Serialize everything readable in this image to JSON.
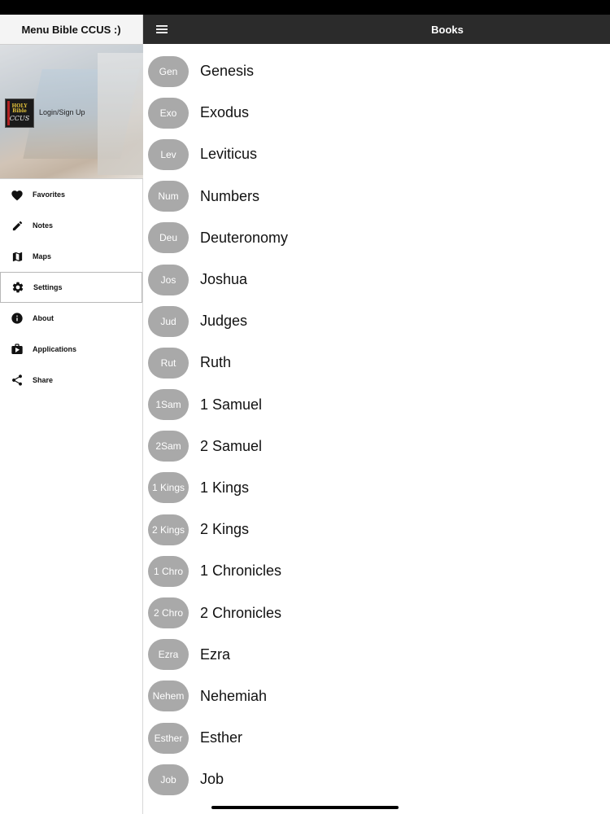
{
  "sidebar": {
    "title": "Menu Bible CCUS :)",
    "logo": {
      "line1": "HOLY",
      "line2": "Bible",
      "line3": "CCUS"
    },
    "login_label": "Login/Sign Up",
    "items": [
      {
        "label": "Favorites",
        "icon": "heart-icon"
      },
      {
        "label": "Notes",
        "icon": "pencil-icon"
      },
      {
        "label": "Maps",
        "icon": "map-icon"
      },
      {
        "label": "Settings",
        "icon": "gear-icon",
        "selected": true
      },
      {
        "label": "About",
        "icon": "info-icon"
      },
      {
        "label": "Applications",
        "icon": "store-icon"
      },
      {
        "label": "Share",
        "icon": "share-icon"
      }
    ]
  },
  "header": {
    "title": "Books"
  },
  "books": [
    {
      "abbr": "Gen",
      "name": "Genesis"
    },
    {
      "abbr": "Exo",
      "name": "Exodus"
    },
    {
      "abbr": "Lev",
      "name": "Leviticus"
    },
    {
      "abbr": "Num",
      "name": "Numbers"
    },
    {
      "abbr": "Deu",
      "name": "Deuteronomy"
    },
    {
      "abbr": "Jos",
      "name": "Joshua"
    },
    {
      "abbr": "Jud",
      "name": "Judges"
    },
    {
      "abbr": "Rut",
      "name": "Ruth"
    },
    {
      "abbr": "1Sam",
      "name": "1 Samuel"
    },
    {
      "abbr": "2Sam",
      "name": "2 Samuel"
    },
    {
      "abbr": "1 Kings",
      "name": "1 Kings"
    },
    {
      "abbr": "2 Kings",
      "name": "2 Kings"
    },
    {
      "abbr": "1 Chro",
      "name": "1 Chronicles"
    },
    {
      "abbr": "2 Chro",
      "name": "2 Chronicles"
    },
    {
      "abbr": "Ezra",
      "name": "Ezra"
    },
    {
      "abbr": "Nehem",
      "name": "Nehemiah"
    },
    {
      "abbr": "Esther",
      "name": "Esther"
    },
    {
      "abbr": "Job",
      "name": "Job"
    }
  ],
  "colors": {
    "topbar": "#2b2b2b",
    "pill": "#a9a9a9",
    "status_bar": "#000000"
  }
}
